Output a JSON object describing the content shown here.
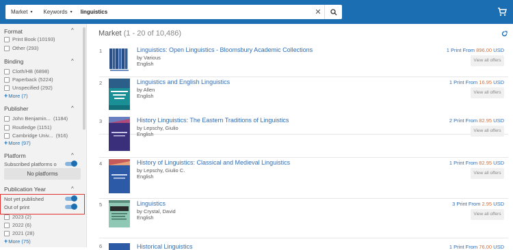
{
  "search": {
    "market_label": "Market",
    "keywords_label": "Keywords",
    "query": "linguistics"
  },
  "facets": {
    "format": {
      "title": "Format",
      "options": [
        "Print Book (10193)",
        "Other (293)"
      ]
    },
    "binding": {
      "title": "Binding",
      "options": [
        "Cloth/HB (6898)",
        "Paperback (5224)",
        "Unspecified (292)"
      ],
      "more": "More (7)"
    },
    "publisher": {
      "title": "Publisher",
      "options": [
        {
          "name": "John Benjamin...",
          "count": "(1184)"
        },
        {
          "name": "Routledge (1151)",
          "count": ""
        },
        {
          "name": "Cambridge Univ...",
          "count": "(916)"
        }
      ],
      "more": "More (97)"
    },
    "platform": {
      "title": "Platform",
      "toggle_label": "Subscribed platforms o",
      "no_platforms": "No platforms"
    },
    "publication_year": {
      "title": "Publication Year",
      "toggles": [
        "Not yet published",
        "Out of print"
      ],
      "options": [
        "2023 (2)",
        "2022 (6)",
        "2021 (28)"
      ],
      "more": "More (75)"
    }
  },
  "results": {
    "title": "Market",
    "range": "(1 - 20 of 10,486)",
    "items": [
      {
        "num": "1",
        "title": "Linguistics: Open Linguistics - Bloomsbury Academic Collections",
        "by": "by Various",
        "lang": "English",
        "prints": "1 Print From",
        "amount": "896.00",
        "currency": "USD",
        "offers": "View all offers"
      },
      {
        "num": "2",
        "title": "Linguistics and English Linguistics",
        "by": "by Allen",
        "lang": "English",
        "prints": "1 Print From",
        "amount": "16.95",
        "currency": "USD",
        "offers": "View all offers"
      },
      {
        "num": "3",
        "title": "History Linguistics: The Eastern Traditions of Linguistics",
        "by": "by Lepschy, Giulio",
        "lang": "English",
        "prints": "2 Print From",
        "amount": "82.95",
        "currency": "USD",
        "offers": "View all offers"
      },
      {
        "num": "4",
        "title": "History of Linguistics: Classical and Medieval Linguistics",
        "by": "by Lepschy, Giulio C.",
        "lang": "English",
        "prints": "1 Print From",
        "amount": "82.95",
        "currency": "USD",
        "offers": "View all offers"
      },
      {
        "num": "5",
        "title": "Linguistics",
        "by": "by Crystal, David",
        "lang": "English",
        "prints": "3 Print From",
        "amount": "2.95",
        "currency": "USD",
        "offers": "View all offers"
      },
      {
        "num": "6",
        "title": "Historical Linguistics",
        "by": "",
        "lang": "",
        "prints": "1 Print From",
        "amount": "76.00",
        "currency": "USD",
        "offers": ""
      }
    ]
  },
  "colors": {
    "brand": "#1c6eb3",
    "link": "#2e6cb5",
    "price": "#e06a24",
    "highlight": "#e0312e"
  }
}
